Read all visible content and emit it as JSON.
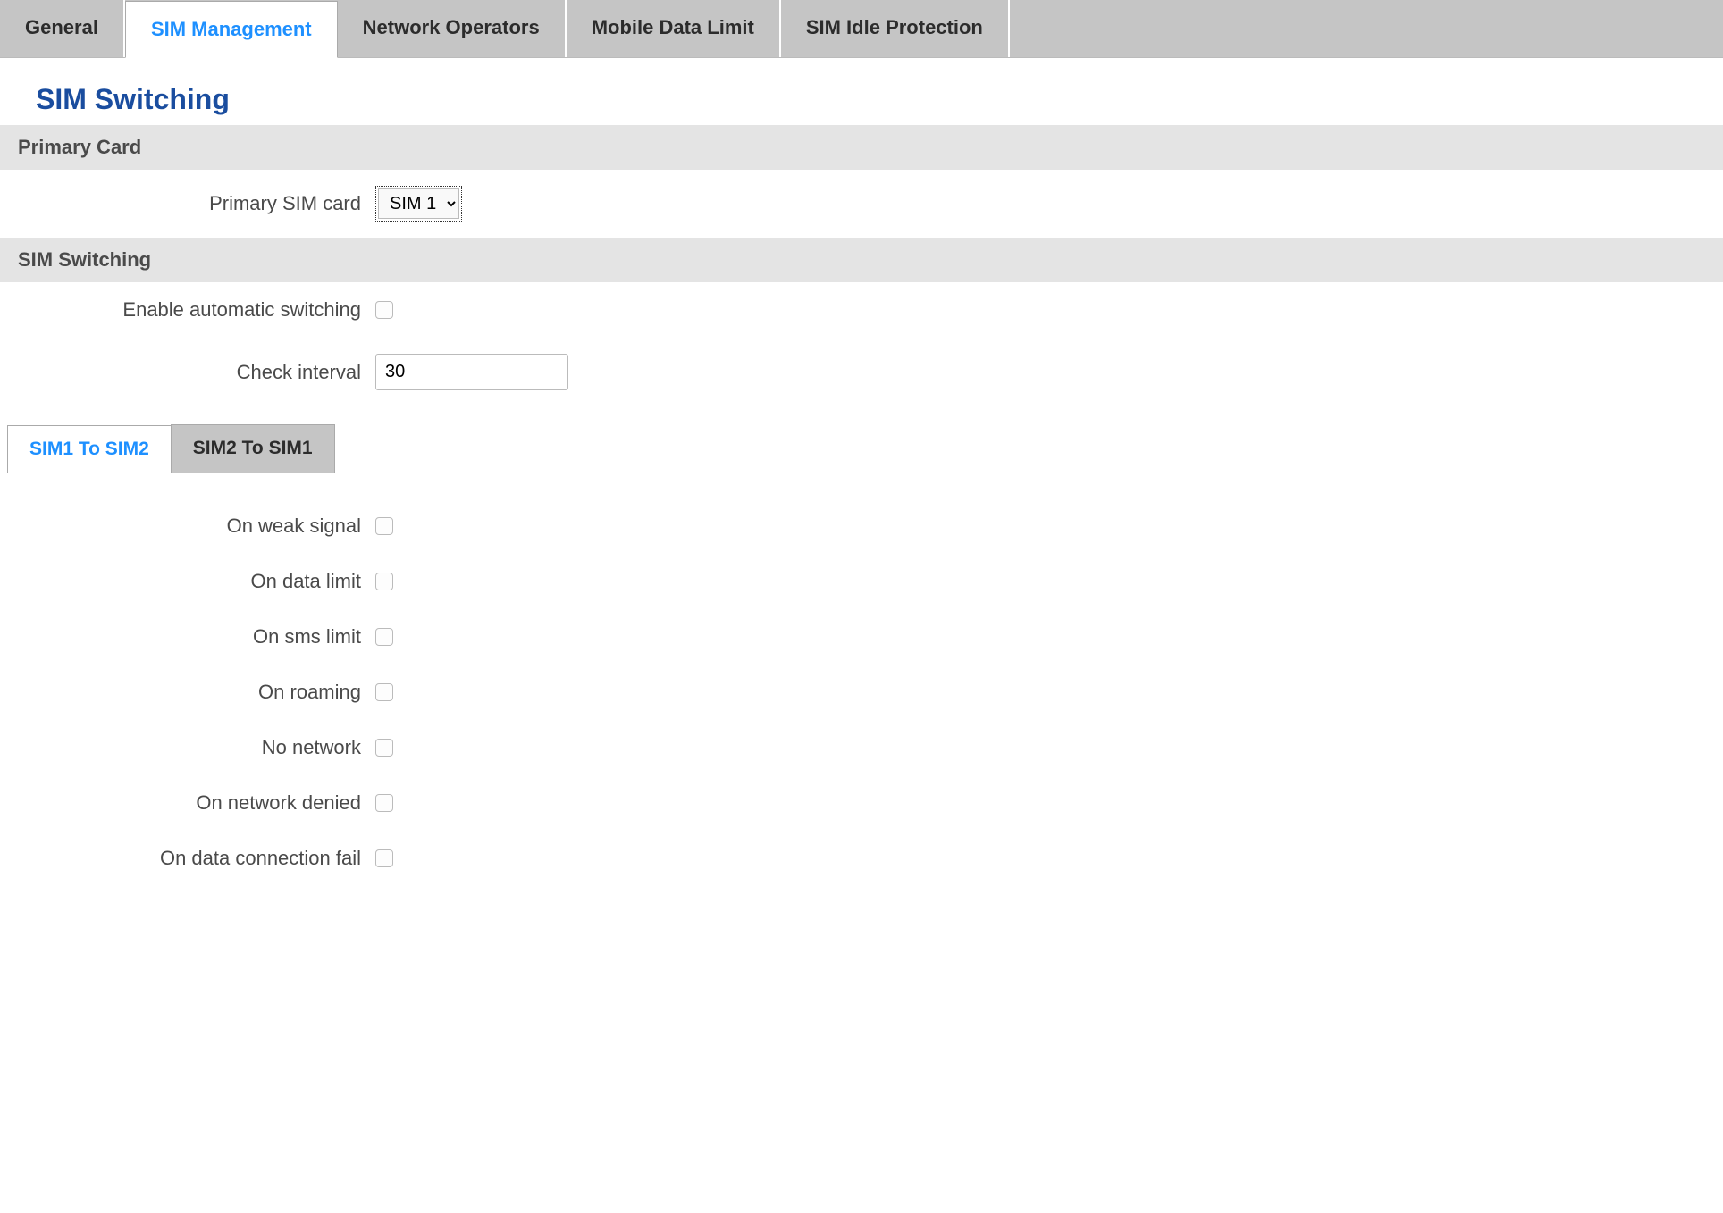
{
  "topTabs": {
    "general": "General",
    "simManagement": "SIM Management",
    "networkOperators": "Network Operators",
    "mobileDataLimit": "Mobile Data Limit",
    "simIdleProtection": "SIM Idle Protection"
  },
  "pageTitle": "SIM Switching",
  "sections": {
    "primaryCard": {
      "header": "Primary Card",
      "primarySimLabel": "Primary SIM card",
      "primarySimValue": "SIM 1"
    },
    "simSwitching": {
      "header": "SIM Switching",
      "enableAutoLabel": "Enable automatic switching",
      "checkIntervalLabel": "Check interval",
      "checkIntervalValue": "30"
    }
  },
  "subTabs": {
    "sim1to2": "SIM1 To SIM2",
    "sim2to1": "SIM2 To SIM1"
  },
  "switchConditions": {
    "onWeakSignal": "On weak signal",
    "onDataLimit": "On data limit",
    "onSmsLimit": "On sms limit",
    "onRoaming": "On roaming",
    "noNetwork": "No network",
    "onNetworkDenied": "On network denied",
    "onDataConnectionFail": "On data connection fail"
  }
}
